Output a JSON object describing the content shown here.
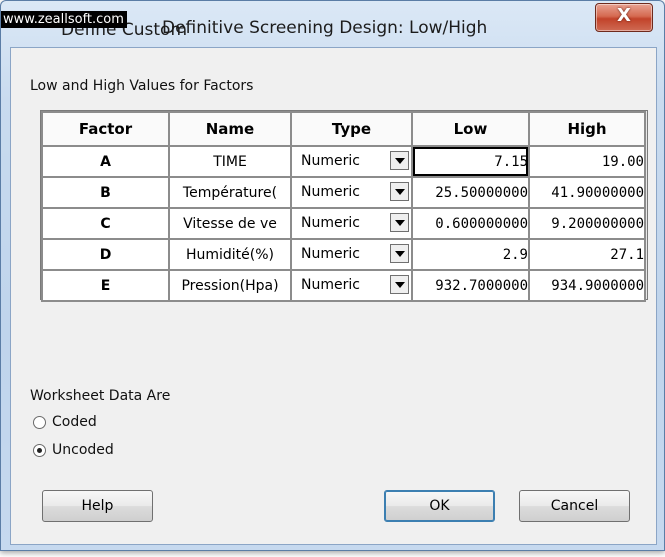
{
  "watermark": "www.zeallsoft.com",
  "window": {
    "title": "Definitive Screening Design: Low/High",
    "title_partial": "Define Custom",
    "close_label": "X"
  },
  "group_label": "Low and High Values for Factors",
  "table": {
    "headers": [
      "Factor",
      "Name",
      "Type",
      "Low",
      "High"
    ],
    "rows": [
      {
        "factor": "A",
        "name": "TIME",
        "type": "Numeric",
        "low": "7.15",
        "high": "19.00"
      },
      {
        "factor": "B",
        "name": "Température(",
        "type": "Numeric",
        "low": "25.50000000",
        "high": "41.90000000"
      },
      {
        "factor": "C",
        "name": "Vitesse de ve",
        "type": "Numeric",
        "low": "0.600000000",
        "high": "9.200000000"
      },
      {
        "factor": "D",
        "name": "Humidité(%)",
        "type": "Numeric",
        "low": "2.9",
        "high": "27.1"
      },
      {
        "factor": "E",
        "name": "Pression(Hpa)",
        "type": "Numeric",
        "low": "932.7000000",
        "high": "934.9000000"
      }
    ]
  },
  "worksheet": {
    "label": "Worksheet Data Are",
    "options": [
      {
        "label": "Coded",
        "selected": false
      },
      {
        "label": "Uncoded",
        "selected": true
      }
    ]
  },
  "buttons": {
    "help": "Help",
    "ok": "OK",
    "cancel": "Cancel"
  }
}
